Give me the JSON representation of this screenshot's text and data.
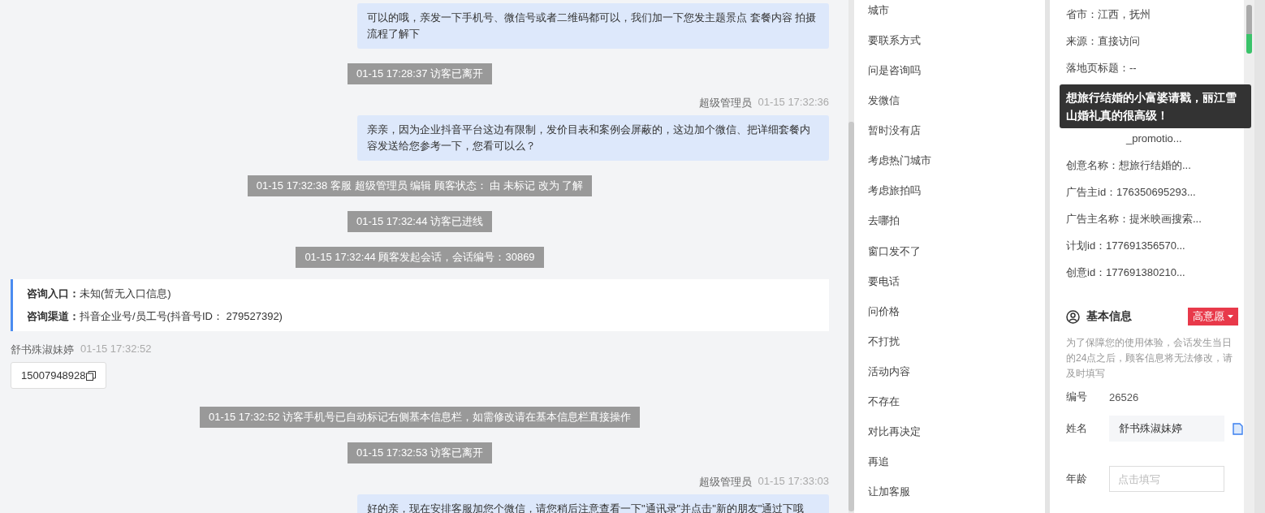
{
  "chat": {
    "messages": [
      {
        "kind": "agent",
        "text": "可以的哦，亲发一下手机号、微信号或者二维码都可以，我们加一下您发主题景点 套餐内容 拍摄流程了解下"
      },
      {
        "kind": "system",
        "text": "01-15 17:28:37 访客已离开"
      },
      {
        "kind": "agent",
        "sender": "超级管理员",
        "time": "01-15 17:32:36",
        "text": "亲亲，因为企业抖音平台这边有限制，发价目表和案例会屏蔽的，这边加个微信、把详细套餐内容发送给您参考一下，您看可以么？"
      },
      {
        "kind": "system",
        "text": "01-15 17:32:38 客服 超级管理员 编辑 顾客状态： 由 未标记 改为 了解"
      },
      {
        "kind": "system",
        "text": "01-15 17:32:44 访客已进线"
      },
      {
        "kind": "system",
        "text": "01-15 17:32:44 顾客发起会话，会话编号：30869"
      },
      {
        "kind": "entry",
        "lines": [
          {
            "label": "咨询入口：",
            "value": "未知(暂无入口信息)"
          },
          {
            "label": "咨询渠道：",
            "value": "抖音企业号/员工号(抖音号ID： 279527392)"
          }
        ]
      },
      {
        "kind": "visitor",
        "sender": "舒书殊淑妹婷",
        "time": "01-15 17:32:52",
        "text": "15007948928"
      },
      {
        "kind": "system",
        "text": "01-15 17:32:52 访客手机号已自动标记右侧基本信息栏，如需修改请在基本信息栏直接操作"
      },
      {
        "kind": "system",
        "text": "01-15 17:32:53 访客已离开"
      },
      {
        "kind": "agent",
        "sender": "超级管理员",
        "time": "01-15 17:33:03",
        "text": "好的亲，现在安排客服加您个微信，请您稍后注意查看一下\"通讯录\"并点击\"新的朋友\"通过下哦"
      }
    ]
  },
  "quick_replies": [
    "城市",
    "要联系方式",
    "问是咨询吗",
    "发微信",
    "暂时没有店",
    "考虑热门城市",
    "考虑旅拍吗",
    "去哪拍",
    "窗口发不了",
    "要电话",
    "问价格",
    "不打扰",
    "活动内容",
    "不存在",
    "对比再决定",
    "再追",
    "让加客服"
  ],
  "visitor_info": {
    "rows": [
      "省市：江西，抚州",
      "来源：直接访问",
      "落地页标题：--",
      null,
      "_promotio...",
      "创意名称：想旅行结婚的...",
      "广告主id：176350695293...",
      "广告主名称：提米映画搜索...",
      "计划id：177691356570...",
      "创意id：177691380210..."
    ],
    "tooltip": "想旅行结婚的小富婆请戳，丽江雪山婚礼真的很高级！"
  },
  "basic_info": {
    "title": "基本信息",
    "intent": "高意愿",
    "notice": "为了保障您的使用体验，会话发生当日的24点之后，顾客信息将无法修改，请及时填写",
    "fields": [
      {
        "kind": "static",
        "label": "编号",
        "value": "26526"
      },
      {
        "kind": "copy",
        "label": "姓名",
        "value": "舒书殊淑妹婷"
      },
      {
        "kind": "input",
        "label": "年龄",
        "placeholder": "点击填写"
      }
    ]
  }
}
